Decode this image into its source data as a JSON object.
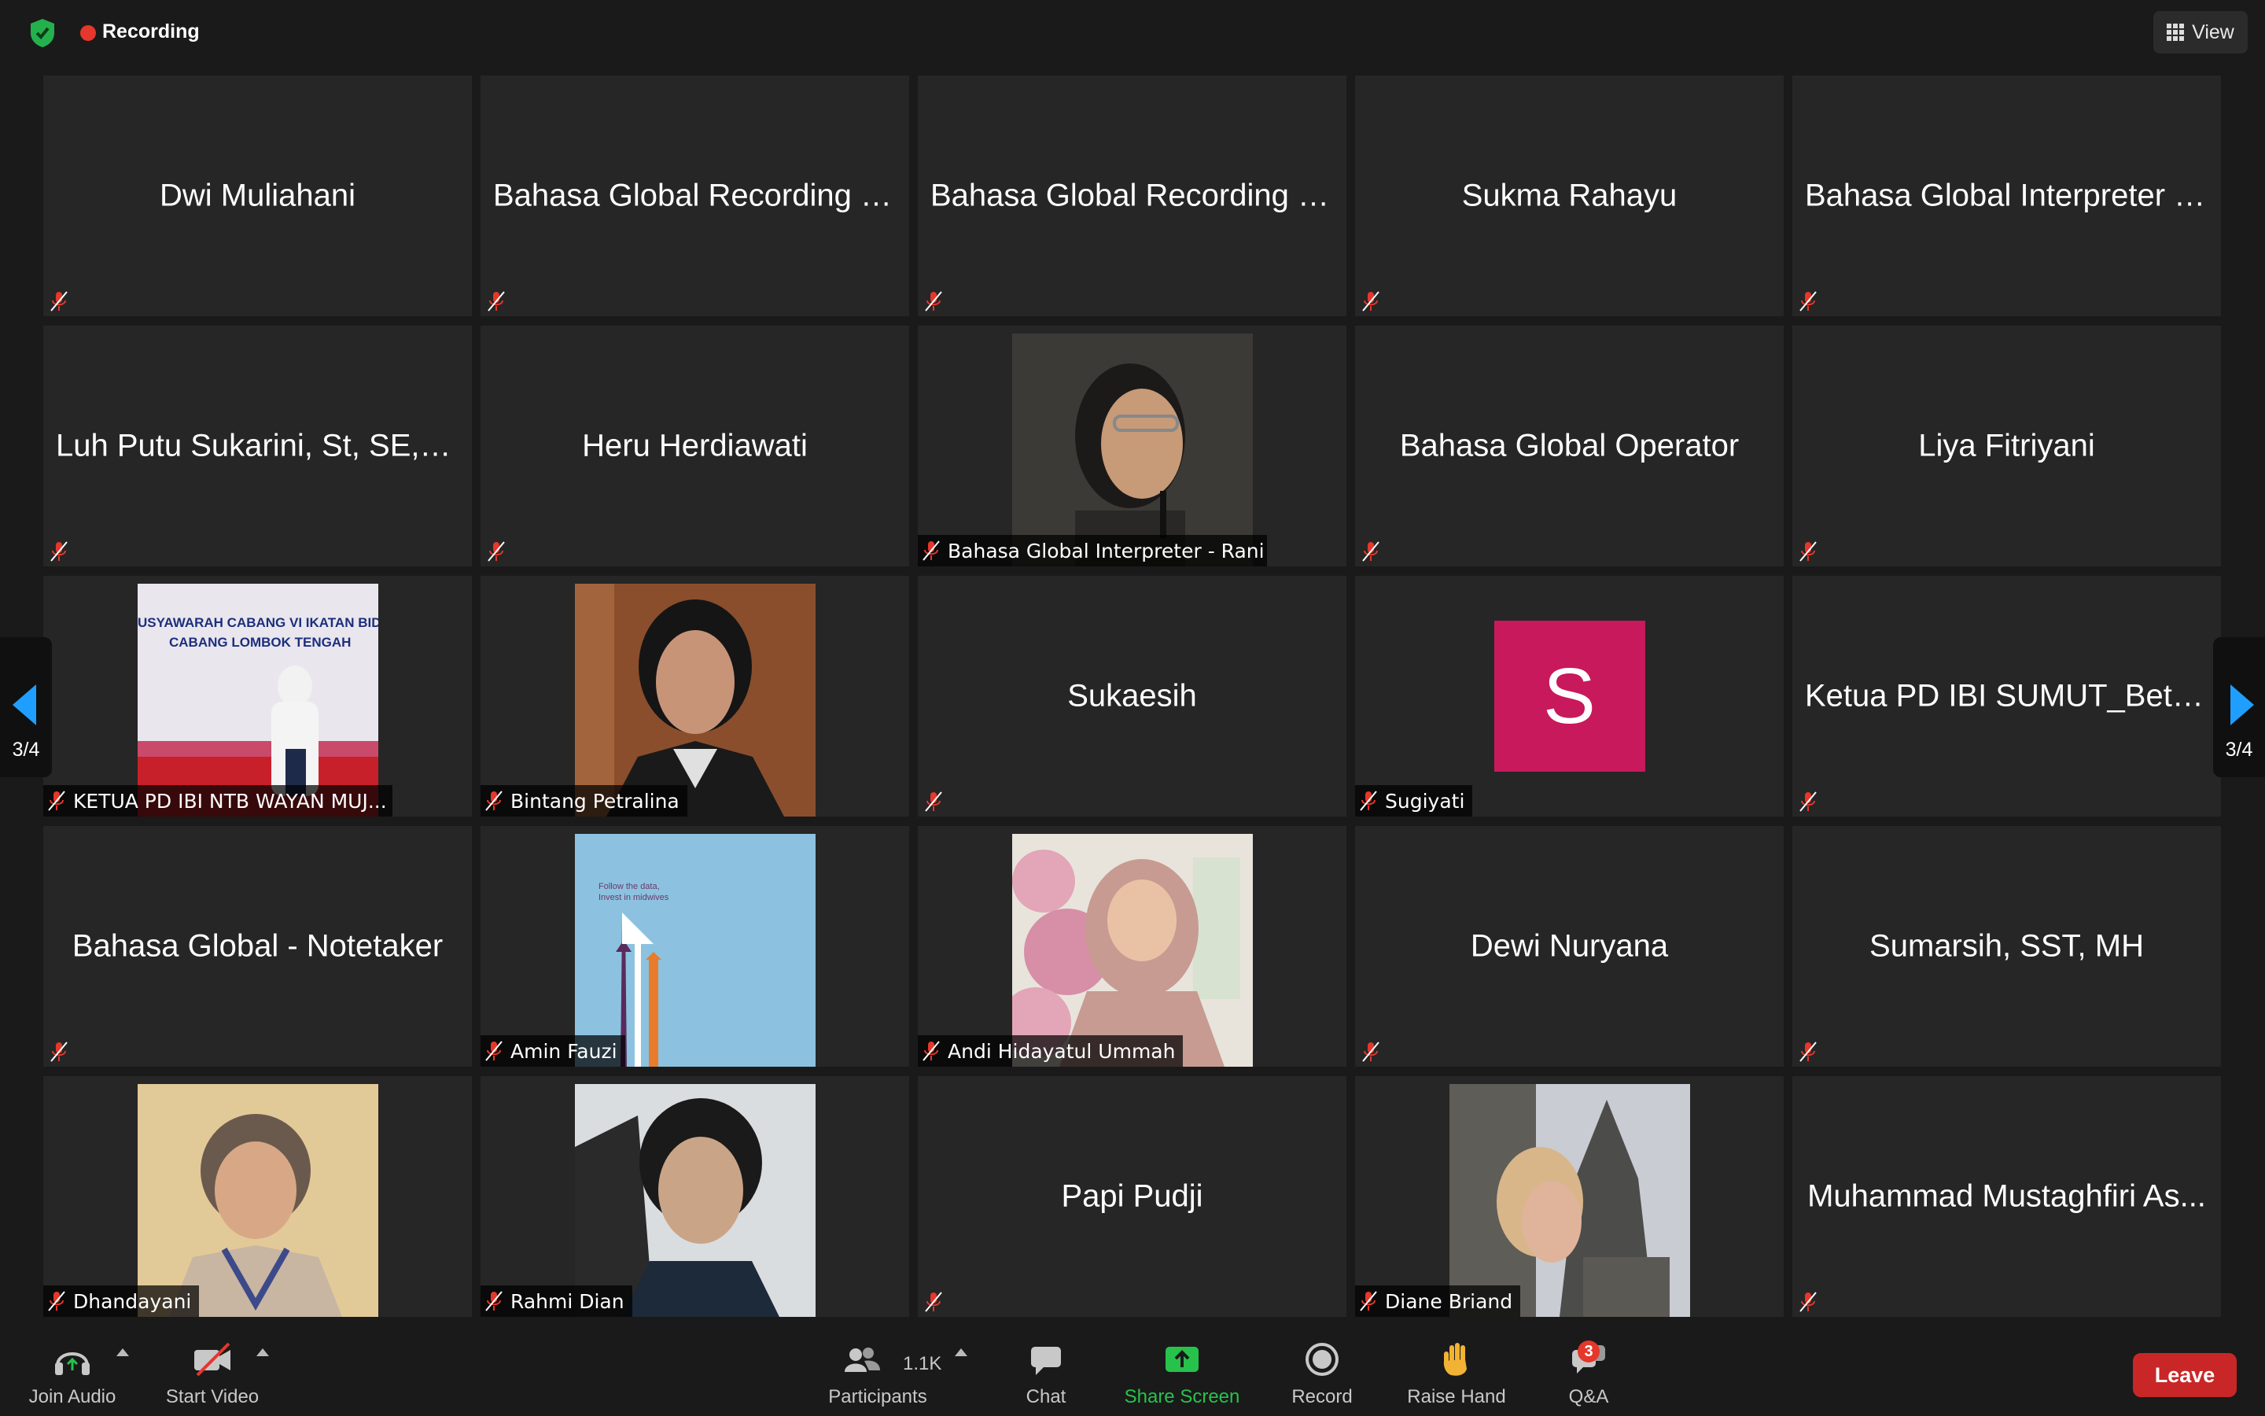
{
  "top_bar": {
    "recording_label": "Recording",
    "view_label": "View"
  },
  "pagination": {
    "left": "3/4",
    "right": "3/4"
  },
  "tiles": [
    {
      "name": "Dwi Muliahani",
      "type": "name"
    },
    {
      "name": "Bahasa Global Recording -...",
      "type": "name"
    },
    {
      "name": "Bahasa Global Recording -...",
      "type": "name"
    },
    {
      "name": "Sukma Rahayu",
      "type": "name"
    },
    {
      "name": "Bahasa Global Interpreter -...",
      "type": "name"
    },
    {
      "name": "Luh Putu Sukarini, St, SE, M...",
      "type": "name"
    },
    {
      "name": "Heru Herdiawati",
      "type": "name"
    },
    {
      "name": "Bahasa Global Interpreter - Rani",
      "type": "photo"
    },
    {
      "name": "Bahasa Global Operator",
      "type": "name"
    },
    {
      "name": "Liya Fitriyani",
      "type": "name"
    },
    {
      "name": "KETUA PD IBI NTB WAYAN MUJ...",
      "type": "photo",
      "banner_lines": [
        "USYAWARAH CABANG VI IKATAN BIDAN INDONE",
        "CABANG LOMBOK TENGAH"
      ]
    },
    {
      "name": "Bintang Petralina",
      "type": "photo"
    },
    {
      "name": "Sukaesih",
      "type": "name"
    },
    {
      "name": "Sugiyati",
      "type": "avatar",
      "initial": "S",
      "color": "#c7195b"
    },
    {
      "name": "Ketua PD IBI SUMUT_Betty...",
      "type": "name"
    },
    {
      "name": "Bahasa Global - Notetaker",
      "type": "name"
    },
    {
      "name": "Amin Fauzi",
      "type": "photo",
      "poster_text": [
        "Follow the data,",
        "Invest in midwives"
      ]
    },
    {
      "name": "Andi Hidayatul Ummah",
      "type": "photo"
    },
    {
      "name": "Dewi Nuryana",
      "type": "name"
    },
    {
      "name": "Sumarsih, SST, MH",
      "type": "name"
    },
    {
      "name": "Dhandayani",
      "type": "photo"
    },
    {
      "name": "Rahmi Dian",
      "type": "photo"
    },
    {
      "name": "Papi Pudji",
      "type": "name"
    },
    {
      "name": "Diane Briand",
      "type": "photo"
    },
    {
      "name": "Muhammad Mustaghfiri As...",
      "type": "name"
    }
  ],
  "toolbar": {
    "join_audio": "Join Audio",
    "start_video": "Start Video",
    "participants": "Participants",
    "participants_count": "1.1K",
    "chat": "Chat",
    "share_screen": "Share Screen",
    "record": "Record",
    "raise_hand": "Raise Hand",
    "qa": "Q&A",
    "qa_badge": "3",
    "leave": "Leave"
  },
  "colors": {
    "accent_blue": "#1e9fff",
    "share_green": "#27c24c",
    "leave_red": "#c92727",
    "mute_red": "#e5372b"
  }
}
